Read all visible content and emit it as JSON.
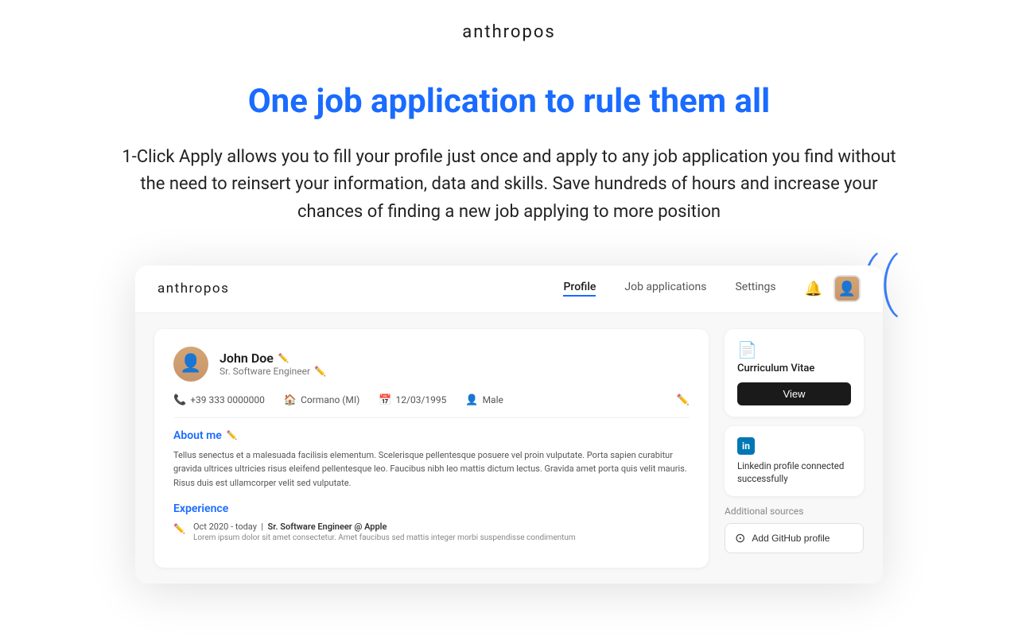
{
  "header": {
    "brand": "anthropos"
  },
  "hero": {
    "title": "One job application to rule them all",
    "description": "1-Click Apply allows you to fill your profile just once and apply to any job application you find without the need to reinsert your information, data and skills. Save hundreds of hours and increase your chances of finding a new job applying to more position"
  },
  "app": {
    "brand": "anthropos",
    "nav": {
      "links": [
        {
          "label": "Profile",
          "active": true
        },
        {
          "label": "Job applications",
          "active": false
        },
        {
          "label": "Settings",
          "active": false
        }
      ]
    },
    "profile": {
      "name": "John Doe",
      "title": "Sr. Software Engineer",
      "phone": "+39 333 0000000",
      "location": "Cormano (MI)",
      "dob": "12/03/1995",
      "gender": "Male",
      "about_title": "About me",
      "about_text": "Tellus senectus et a malesuada facilisis elementum. Scelerisque pellentesque posuere vel proin vulputate. Porta sapien curabitur gravida ultrices ultricies risus eleifend pellentesque leo. Faucibus nibh leo mattis dictum lectus. Gravida amet porta quis velit mauris. Risus duis est ullamcorper velit sed vulputate.",
      "experience_title": "Experience",
      "experience": [
        {
          "period": "Oct 2020 - today",
          "role": "Sr. Software Engineer @ Apple",
          "description": "Lorem ipsum dolor sit amet consectetur. Amet faucibus sed mattis integer morbi suspendisse condimentum"
        }
      ]
    },
    "sidebar": {
      "cv_label": "Curriculum Vitae",
      "view_btn": "View",
      "linkedin_label": "Linkedin profile connected successfully",
      "additional_sources": "Additional sources",
      "github_btn": "Add GitHub profile"
    }
  }
}
